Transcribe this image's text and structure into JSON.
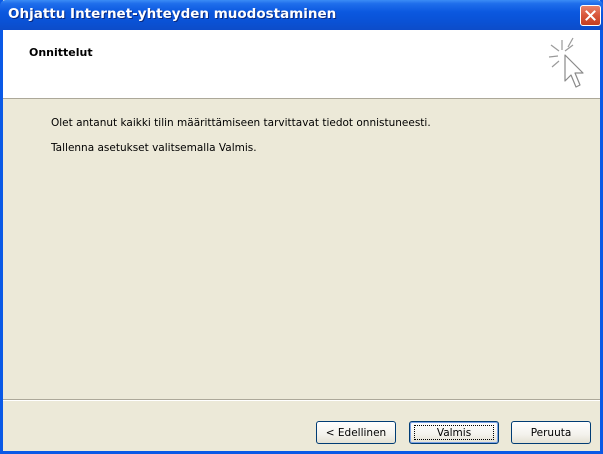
{
  "window": {
    "title": "Ohjattu Internet-yhteyden muodostaminen"
  },
  "header": {
    "title": "Onnittelut",
    "icon": "wizard-cursor-sparkle-icon"
  },
  "body": {
    "line1": "Olet antanut kaikki tilin määrittämiseen tarvittavat tiedot onnistuneesti.",
    "line2": "Tallenna asetukset valitsemalla Valmis."
  },
  "buttons": {
    "back": "< Edellinen",
    "finish": "Valmis",
    "cancel": "Peruuta"
  },
  "colors": {
    "titlebar": "#0A52D6",
    "dialog_bg": "#ECE9D8",
    "close_button": "#D8563A"
  }
}
